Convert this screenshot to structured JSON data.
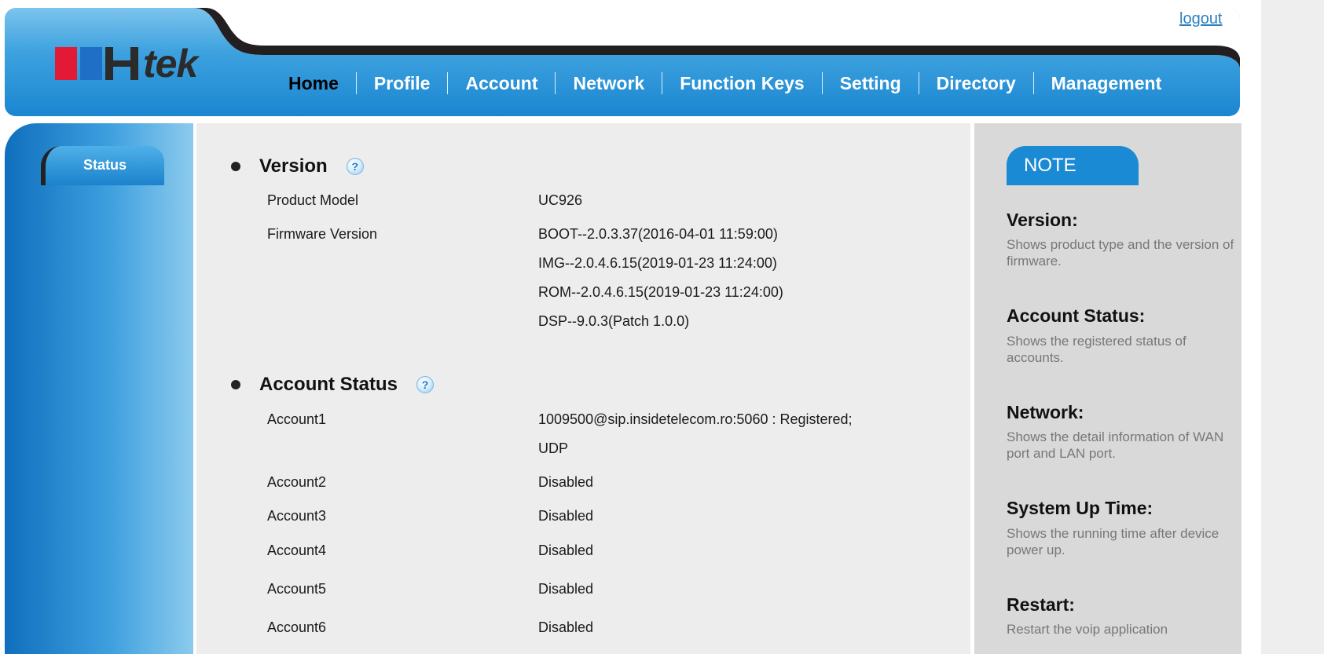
{
  "header": {
    "logout_label": "logout",
    "logo_text": "Htek",
    "nav": [
      {
        "label": "Home",
        "active": true
      },
      {
        "label": "Profile"
      },
      {
        "label": "Account"
      },
      {
        "label": "Network"
      },
      {
        "label": "Function Keys"
      },
      {
        "label": "Setting"
      },
      {
        "label": "Directory"
      },
      {
        "label": "Management"
      }
    ]
  },
  "sidebar": {
    "items": [
      {
        "label": "Status",
        "active": true
      }
    ]
  },
  "version": {
    "title": "Version",
    "product_model_label": "Product Model",
    "product_model_value": "UC926",
    "firmware_label": "Firmware Version",
    "firmware_values": [
      "BOOT--2.0.3.37(2016-04-01 11:59:00)",
      "IMG--2.0.4.6.15(2019-01-23 11:24:00)",
      "ROM--2.0.4.6.15(2019-01-23 11:24:00)",
      "DSP--9.0.3(Patch 1.0.0)"
    ]
  },
  "account_status": {
    "title": "Account Status",
    "accounts": [
      {
        "label": "Account1",
        "value": "1009500@sip.insidetelecom.ro:5060 : Registered;",
        "value2": "UDP"
      },
      {
        "label": "Account2",
        "value": "Disabled"
      },
      {
        "label": "Account3",
        "value": "Disabled"
      },
      {
        "label": "Account4",
        "value": "Disabled"
      },
      {
        "label": "Account5",
        "value": "Disabled"
      },
      {
        "label": "Account6",
        "value": "Disabled"
      }
    ]
  },
  "note": {
    "badge": "NOTE",
    "items": [
      {
        "heading": "Version:",
        "text": "Shows product type and the version of firmware."
      },
      {
        "heading": "Account Status:",
        "text": "Shows the registered status of accounts."
      },
      {
        "heading": "Network:",
        "text": "Shows the detail information of WAN port and LAN port."
      },
      {
        "heading": "System Up Time:",
        "text": "Shows the running time after device power up."
      },
      {
        "heading": "Restart:",
        "text": "Restart the voip application"
      }
    ]
  },
  "colors": {
    "brand_blue": "#1b8ad4",
    "logo_red": "#e21a35",
    "content_bg": "#ededed",
    "note_bg": "#d9d9d9"
  },
  "icons": {
    "help": "help-question-icon",
    "bullet": "bullet-icon"
  }
}
